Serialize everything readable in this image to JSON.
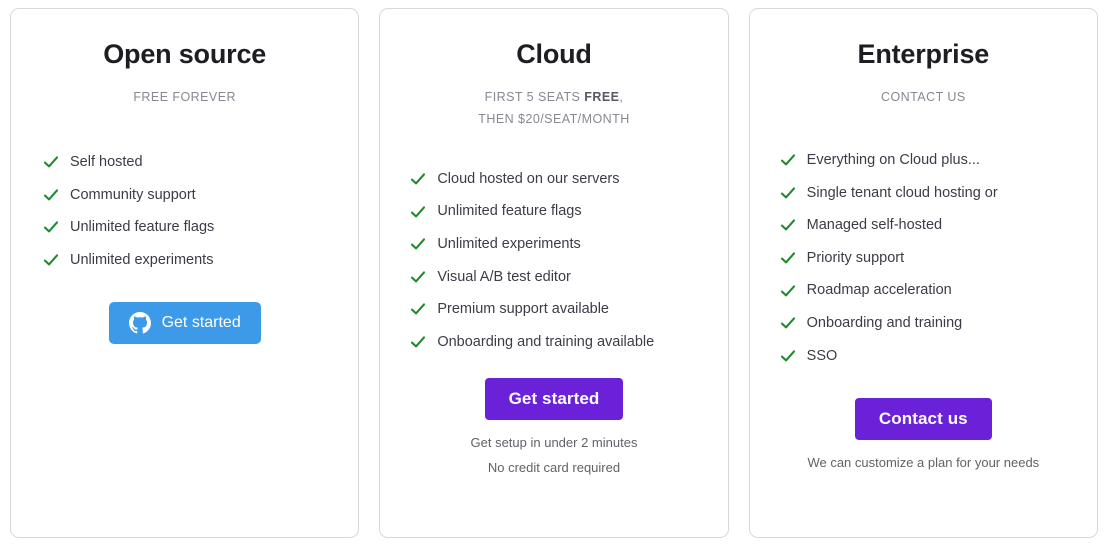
{
  "colors": {
    "check": "#1f8a2b",
    "github_button": "#3d9ae8",
    "primary_button": "#6b21d8",
    "card_border": "#d8d8d8",
    "title": "#1d1d22",
    "subtitle": "#8a8692",
    "feature_text": "#3d3b47",
    "note_text": "#646069"
  },
  "plans": [
    {
      "id": "open-source",
      "title": "Open source",
      "subtitle_line1": "FREE FOREVER",
      "subtitle_line1_bold": "",
      "subtitle_line1_tail": "",
      "subtitle_line2": "",
      "features": [
        "Self hosted",
        "Community support",
        "Unlimited feature flags",
        "Unlimited experiments"
      ],
      "cta": {
        "label": "Get started",
        "style": "github",
        "icon": "github-icon"
      },
      "notes": []
    },
    {
      "id": "cloud",
      "title": "Cloud",
      "subtitle_line1": "FIRST 5 SEATS ",
      "subtitle_line1_bold": "FREE",
      "subtitle_line1_tail": ",",
      "subtitle_line2": "THEN $20/SEAT/MONTH",
      "features": [
        "Cloud hosted on our servers",
        "Unlimited feature flags",
        "Unlimited experiments",
        "Visual A/B test editor",
        "Premium support available",
        "Onboarding and training available"
      ],
      "cta": {
        "label": "Get started",
        "style": "primary",
        "icon": ""
      },
      "notes": [
        "Get setup in under 2 minutes",
        "No credit card required"
      ]
    },
    {
      "id": "enterprise",
      "title": "Enterprise",
      "subtitle_line1": "CONTACT US",
      "subtitle_line1_bold": "",
      "subtitle_line1_tail": "",
      "subtitle_line2": "",
      "features": [
        "Everything on Cloud plus...",
        "Single tenant cloud hosting or",
        "Managed self-hosted",
        "Priority support",
        "Roadmap acceleration",
        "Onboarding and training",
        "SSO"
      ],
      "cta": {
        "label": "Contact us",
        "style": "primary",
        "icon": ""
      },
      "notes": [
        "We can customize a plan for your needs"
      ]
    }
  ]
}
